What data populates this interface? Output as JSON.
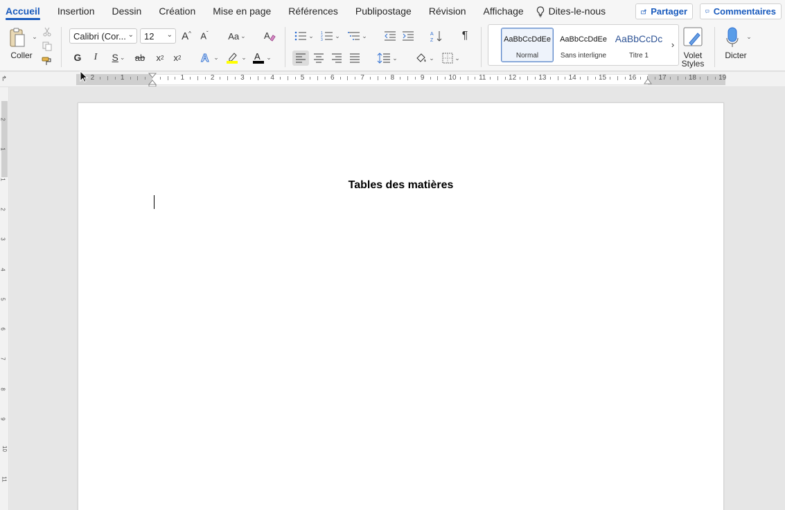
{
  "tabs": [
    {
      "label": "Accueil",
      "active": true
    },
    {
      "label": "Insertion",
      "active": false
    },
    {
      "label": "Dessin",
      "active": false
    },
    {
      "label": "Création",
      "active": false
    },
    {
      "label": "Mise en page",
      "active": false
    },
    {
      "label": "Références",
      "active": false
    },
    {
      "label": "Publipostage",
      "active": false
    },
    {
      "label": "Révision",
      "active": false
    },
    {
      "label": "Affichage",
      "active": false
    }
  ],
  "tell_me": {
    "label": "Dites-le-nous",
    "icon": "lightbulb-icon"
  },
  "share": {
    "label": "Partager",
    "icon": "share-icon"
  },
  "comments": {
    "label": "Commentaires",
    "icon": "comment-icon"
  },
  "ribbon": {
    "paste_label": "Coller",
    "font_name": "Calibri (Cor...",
    "font_size": "12",
    "bold": "G",
    "italic": "I",
    "underline": "S",
    "strike": "ab",
    "subscript": "x",
    "superscript": "x",
    "change_case": "Aa",
    "styles": [
      {
        "sample": "AaBbCcDdEe",
        "name": "Normal",
        "selected": true
      },
      {
        "sample": "AaBbCcDdEe",
        "name": "Sans interligne",
        "selected": false
      },
      {
        "sample": "AaBbCcDc",
        "name": "Titre 1",
        "selected": false
      }
    ],
    "styles_pane_label": "Volet Styles",
    "dictate_label": "Dicter"
  },
  "ruler": {
    "h_numbers": [
      "2",
      "1",
      "1",
      "2",
      "3",
      "4",
      "5",
      "6",
      "7",
      "8",
      "9",
      "10",
      "11",
      "12",
      "13",
      "14",
      "15",
      "16",
      "17",
      "18",
      "19"
    ],
    "v_numbers": [
      "2",
      "1",
      "1",
      "2",
      "3",
      "4",
      "5",
      "6",
      "7",
      "8",
      "9",
      "10",
      "11"
    ]
  },
  "document": {
    "title": "Tables des matières"
  },
  "colors": {
    "accent": "#185abd",
    "highlight": "#ffff00",
    "font_color": "#c00000"
  }
}
